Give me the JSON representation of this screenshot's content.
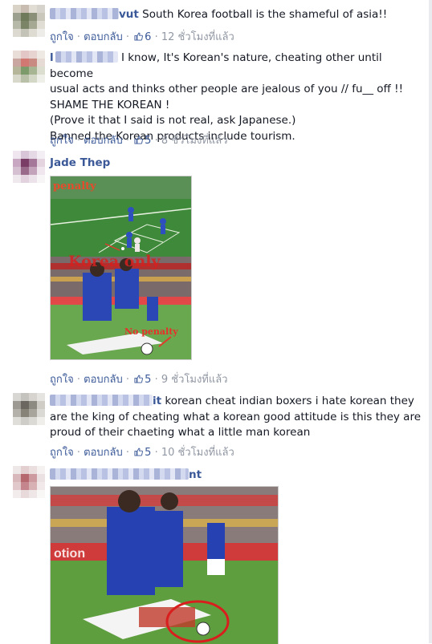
{
  "actions": {
    "like": "ถูกใจ",
    "reply": "ตอบกลับ",
    "sep": "·"
  },
  "comments": [
    {
      "name_suffix": "vut",
      "text": "South Korea football is the shameful of asia!!",
      "likes": "6",
      "time": "12 ชั่วโมงที่แล้ว"
    },
    {
      "name_suffix": "l",
      "text_lines": [
        "I know, It's Korean's nature, cheating other until become",
        "usual acts and thinks other people are jealous of you // fu__ off !!",
        "SHAME THE KOREAN !",
        "(Prove it that I said is not real, ask Japanese.)",
        "Banned the Korean products include tourism."
      ],
      "likes": "5",
      "time": "8 ชั่วโมงที่แล้ว"
    },
    {
      "name": "Jade Thep",
      "photo_labels": {
        "top": "penalty",
        "middle": "Korea only",
        "bottom": "No penalty"
      },
      "likes": "5",
      "time": "9 ชั่วโมงที่แล้ว"
    },
    {
      "name_suffix": "it",
      "text_lines": [
        "korean cheat indian boxers i hate korean they",
        "are the king of cheating what a korean good attitude is this they are",
        "proud of their chaeting what a little man korean"
      ],
      "likes": "5",
      "time": "10 ชั่วโมงที่แล้ว"
    },
    {
      "name_suffix": "nt"
    }
  ],
  "colors": {
    "link": "#3b5998",
    "meta": "#9197a3",
    "text": "#141823"
  },
  "icons": [
    "thumbs-up-icon"
  ]
}
